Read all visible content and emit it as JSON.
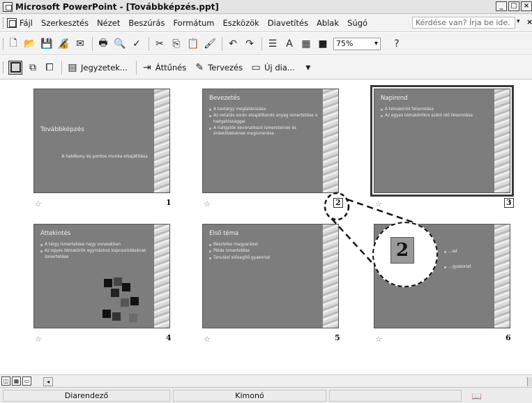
{
  "window": {
    "title": "Microsoft PowerPoint - [Továbbképzés.ppt]",
    "buttons": [
      "_",
      "□",
      "×"
    ]
  },
  "menu": {
    "items": [
      "Fájl",
      "Szerkesztés",
      "Nézet",
      "Beszúrás",
      "Formátum",
      "Eszközök",
      "Diavetítés",
      "Ablak",
      "Súgó"
    ],
    "help_placeholder": "Kérdése van? Írja be ide.",
    "help_arrow": "▾",
    "close": "×"
  },
  "toolbar": {
    "icons": [
      {
        "name": "new-icon",
        "glyph": "🗋"
      },
      {
        "name": "open-icon",
        "glyph": "📂"
      },
      {
        "name": "save-icon",
        "glyph": "💾"
      },
      {
        "name": "permission-icon",
        "glyph": "🔏"
      },
      {
        "name": "email-icon",
        "glyph": "✉"
      },
      {
        "name": "print-icon",
        "glyph": "🖶"
      },
      {
        "name": "print-preview-icon",
        "glyph": "🔍"
      },
      {
        "name": "spelling-icon",
        "glyph": "✓"
      },
      {
        "name": "cut-icon",
        "glyph": "✂"
      },
      {
        "name": "copy-icon",
        "glyph": "⎘"
      },
      {
        "name": "paste-icon",
        "glyph": "📋"
      },
      {
        "name": "format-painter-icon",
        "glyph": "🖌"
      },
      {
        "name": "undo-icon",
        "glyph": "↶"
      },
      {
        "name": "redo-icon",
        "glyph": "↷"
      },
      {
        "name": "expand-all-icon",
        "glyph": "☰"
      },
      {
        "name": "show-formatting-icon",
        "glyph": "A"
      },
      {
        "name": "grid-icon",
        "glyph": "▦"
      },
      {
        "name": "color-grayscale-icon",
        "glyph": "■"
      }
    ],
    "zoom": "75%",
    "help_button": "?"
  },
  "sorter_toolbar": {
    "notes_label": "Jegyzetek...",
    "transition_label": "Áttűnés",
    "design_label": "Tervezés",
    "new_slide_label": "Új dia..."
  },
  "slides": [
    {
      "number": "1",
      "title": "Továbbképzés",
      "subtitle": "A hatékony és pontos munka elsajátítása",
      "bullets": []
    },
    {
      "number": "2",
      "title": "Bevezetés",
      "bullets": [
        "A tantárgy megiatározása",
        "Az oktatás során elsajátítandó anyag ismertetése a hallgatóssággal",
        "A hallgatók kevonatkozó ismereteinek és érdeklődésének megismerése"
      ]
    },
    {
      "number": "3",
      "title": "Napirend",
      "bullets": [
        "A témakörök felsorolása",
        "Az egyes témakörökre szánt idő felsorolása"
      ]
    },
    {
      "number": "4",
      "title": "Áttekintés",
      "bullets": [
        "A tárgy ismertetése nagy vonalakban",
        "Az egyes témakörök egymáshoz kapcsolódásának ismertetése"
      ]
    },
    {
      "number": "5",
      "title": "Első téma",
      "bullets": [
        "Részletes magyarázat",
        "Példa ismertetése",
        "Tanulást elősegítő gyakorlat"
      ]
    },
    {
      "number": "6",
      "title": "",
      "bullets": [
        "...lat",
        "...gyakorlat"
      ]
    }
  ],
  "callout": {
    "magnified_number": "2"
  },
  "status": {
    "view": "Diarendező",
    "design": "Kimonó",
    "book_icon": "📖"
  },
  "view_buttons": [
    "◫",
    "▦",
    "▭"
  ],
  "scroll_left": "◂",
  "slide_meta_glyph": "☆"
}
